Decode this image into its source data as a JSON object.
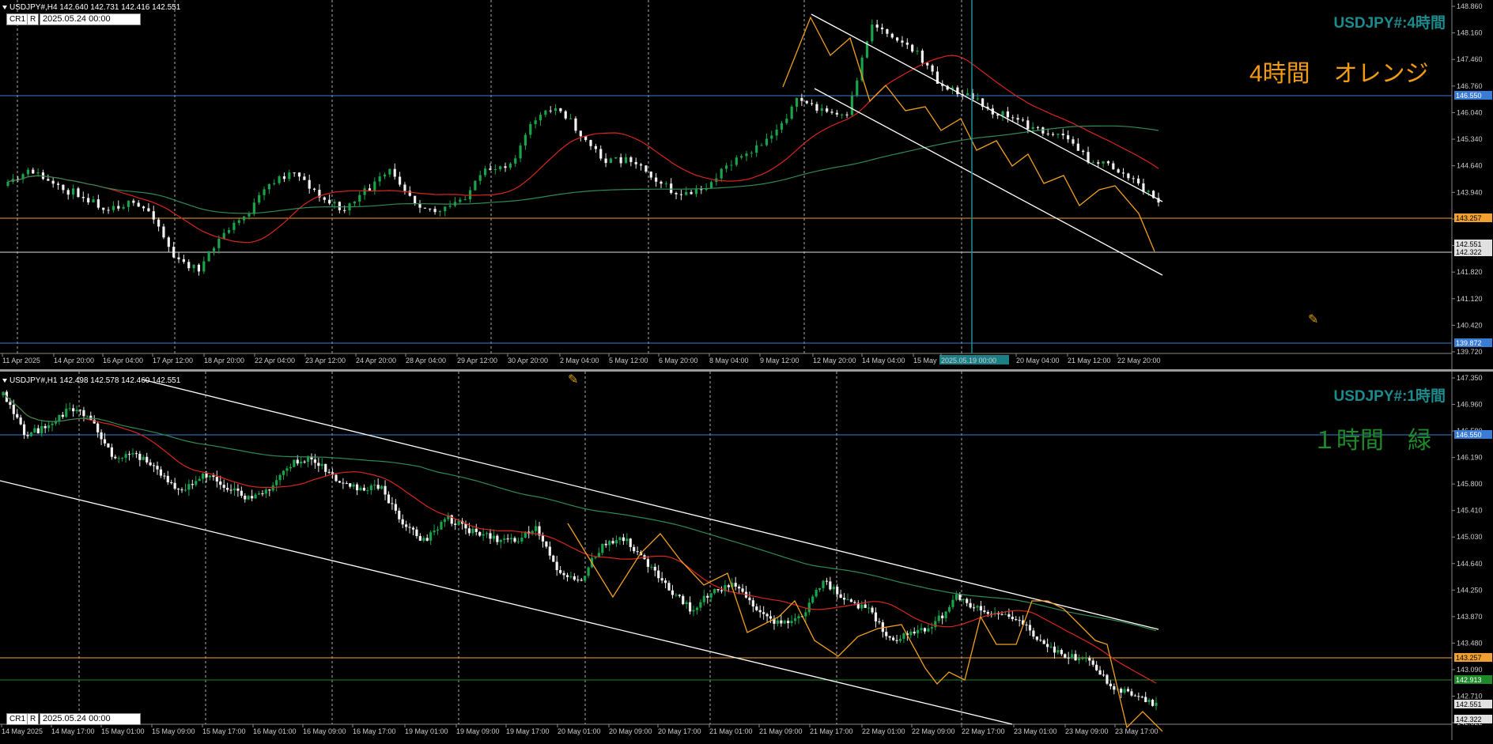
{
  "top": {
    "header": "USDJPY#,H4  142.640 142.731 142.416 142.551",
    "cr_label": "CR1",
    "r_label": "R",
    "date_box": "2025.05.24 00:00",
    "title": "USDJPY#:4時間",
    "note": "4時間　オレンジ",
    "note_color": "#f39c12",
    "price_ticks": [
      "148.860",
      "148.160",
      "147.460",
      "146.760",
      "146.040",
      "145.340",
      "144.640",
      "143.940",
      "143.240",
      "142.540",
      "141.820",
      "141.120",
      "140.420",
      "139.720"
    ],
    "price_tags": [
      {
        "value": "146.550",
        "color": "#3a7bd5"
      },
      {
        "value": "143.257",
        "color": "#f0a030"
      },
      {
        "value": "142.551",
        "color": "#e0e0e0"
      },
      {
        "value": "142.322",
        "color": "#e0e0e0"
      },
      {
        "value": "139.872",
        "color": "#3a7bd5"
      }
    ],
    "time_labels": [
      "11 Apr 2025",
      "14 Apr 20:00",
      "16 Apr 04:00",
      "17 Apr 12:00",
      "18 Apr 20:00",
      "22 Apr 04:00",
      "23 Apr 12:00",
      "24 Apr 20:00",
      "28 Apr 04:00",
      "29 Apr 12:00",
      "30 Apr 20:00",
      "2 May 04:00",
      "5 May 12:00",
      "6 May 20:00",
      "8 May 04:00",
      "9 May 12:00",
      "12 May 20:00",
      "14 May 04:00",
      "15 May",
      "2025.05.19 00:00",
      "20 May 04:00",
      "21 May 12:00",
      "22 May 20:00"
    ]
  },
  "bottom": {
    "header": "USDJPY#,H1  142.498 142.578 142.460 142.551",
    "cr_label": "CR1",
    "r_label": "R",
    "date_box": "2025.05.24 00:00",
    "title": "USDJPY#:1時間",
    "note": "１時間　緑",
    "note_color": "#1e8a2a",
    "price_ticks": [
      "147.350",
      "146.960",
      "146.580",
      "146.190",
      "145.800",
      "145.410",
      "145.030",
      "144.640",
      "144.250",
      "143.870",
      "143.480",
      "143.090",
      "142.710",
      "142.322"
    ],
    "price_tags": [
      {
        "value": "146.550",
        "color": "#3a7bd5"
      },
      {
        "value": "143.257",
        "color": "#f0a030"
      },
      {
        "value": "142.913",
        "color": "#1e8a2a"
      },
      {
        "value": "142.551",
        "color": "#e0e0e0"
      },
      {
        "value": "142.322",
        "color": "#e0e0e0"
      }
    ],
    "time_labels": [
      "14 May 2025",
      "14 May 17:00",
      "15 May 01:00",
      "15 May 09:00",
      "15 May 17:00",
      "16 May 01:00",
      "16 May 09:00",
      "16 May 17:00",
      "19 May 01:00",
      "19 May 09:00",
      "19 May 17:00",
      "20 May 01:00",
      "20 May 09:00",
      "20 May 17:00",
      "21 May 01:00",
      "21 May 09:00",
      "21 May 17:00",
      "22 May 01:00",
      "22 May 09:00",
      "22 May 17:00",
      "23 May 01:00",
      "23 May 09:00",
      "23 May 17:00"
    ]
  }
}
